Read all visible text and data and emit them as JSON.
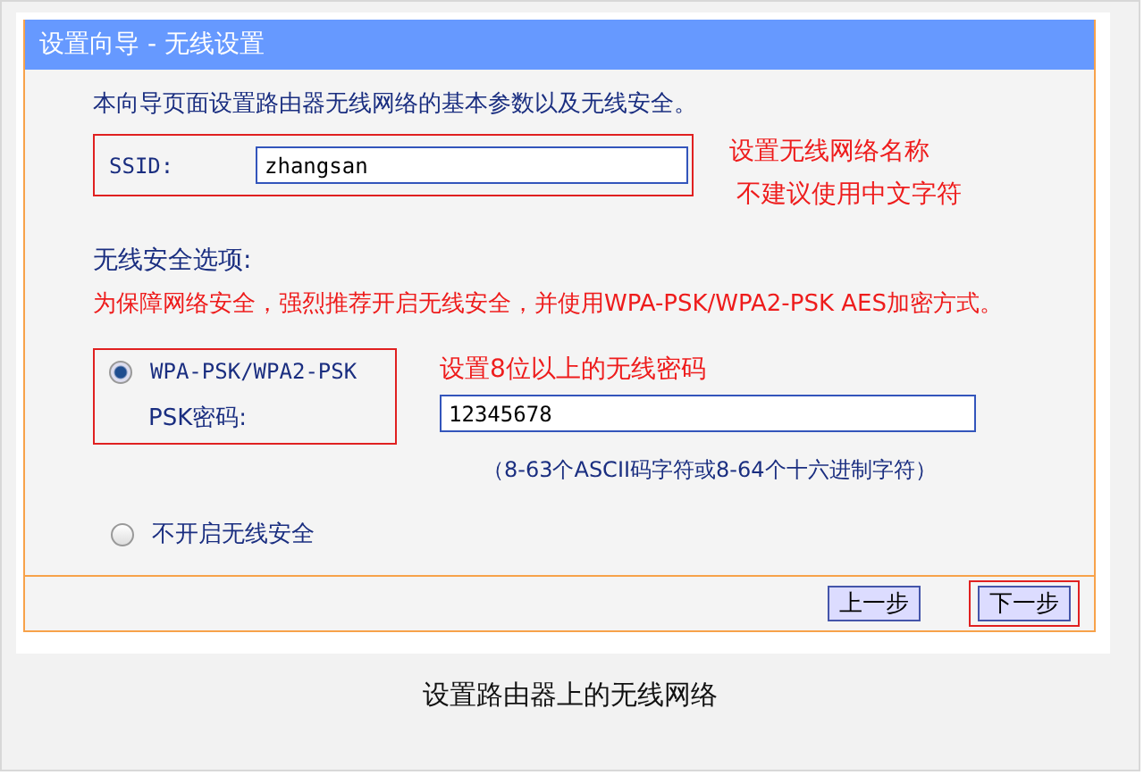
{
  "window": {
    "title": "设置向导 - 无线设置"
  },
  "intro": "本向导页面设置路由器无线网络的基本参数以及无线安全。",
  "ssid": {
    "label": "SSID:",
    "value": "zhangsan",
    "annotations": [
      "设置无线网络名称",
      "不建议使用中文字符"
    ]
  },
  "security": {
    "heading": "无线安全选项:",
    "warning": "为保障网络安全，强烈推荐开启无线安全，并使用WPA-PSK/WPA2-PSK AES加密方式。",
    "options": [
      {
        "label": "WPA-PSK/WPA2-PSK",
        "selected": true
      },
      {
        "label": "不开启无线安全",
        "selected": false
      }
    ],
    "psk": {
      "label": "PSK密码:",
      "value": "12345678",
      "annotation": "设置8位以上的无线密码",
      "hint": "（8-63个ASCII码字符或8-64个十六进制字符）"
    }
  },
  "buttons": [
    {
      "label": "上一步",
      "highlighted": false
    },
    {
      "label": "下一步",
      "highlighted": true
    }
  ],
  "caption": "设置路由器上的无线网络"
}
